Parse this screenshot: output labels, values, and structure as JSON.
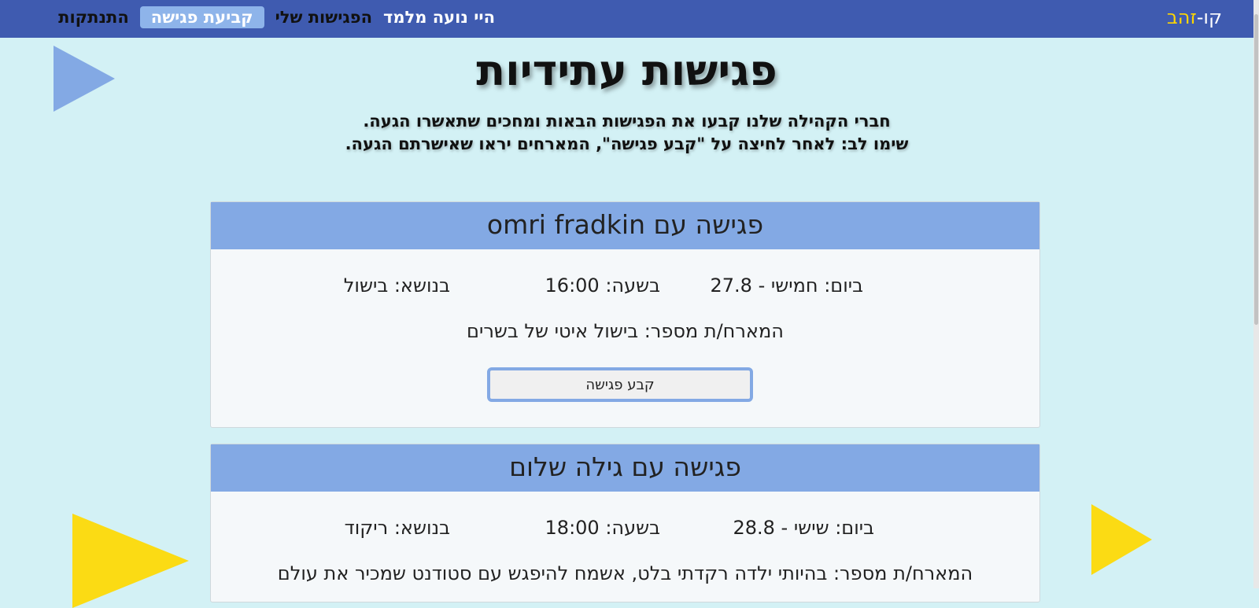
{
  "nav": {
    "brand_prefix": "קו-",
    "brand_gold": "זהב",
    "greeting": "היי נועה מלמד",
    "my_meetings": "הפגישות שלי",
    "schedule_meeting": "קביעת פגישה",
    "logout": "התנתקות"
  },
  "page": {
    "title": "פגישות עתידיות",
    "intro_line1": "חברי הקהילה שלנו קבעו את הפגישות הבאות ומחכים שתאשרו הגעה.",
    "intro_line2": "שימו לב: לאחר לחיצה על \"קבע פגישה\", המארחים יראו שאישרתם הגעה."
  },
  "meetings": [
    {
      "title": "פגישה עם omri fradkin",
      "day": "ביום: חמישי - 27.8",
      "time": "בשעה: 16:00",
      "topic": "בנושא: בישול",
      "host_desc": "המארח/ת מספר: בישול איטי של בשרים",
      "button_label": "קבע פגישה"
    },
    {
      "title": "פגישה עם גילה שלום",
      "day": "ביום: שישי - 28.8",
      "time": "בשעה: 18:00",
      "topic": "בנושא: ריקוד",
      "host_desc": "המארח/ת מספר: בהיותי ילדה רקדתי בלט, אשמח להיפגש עם סטודנט שמכיר את עולם"
    }
  ],
  "colors": {
    "navbar": "#3f5bb0",
    "background": "#d3f1f5",
    "card_header": "#83a9e4",
    "accent_yellow": "#fbdb14"
  }
}
